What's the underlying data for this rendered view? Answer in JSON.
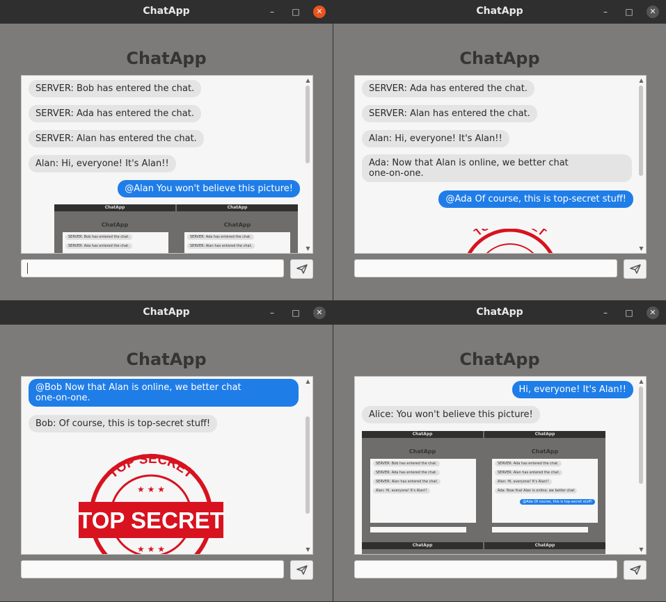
{
  "windows": [
    {
      "title": "ChatApp",
      "app_title": "ChatApp",
      "messages": [
        {
          "text": "SERVER: Bob has entered the chat.",
          "own": false
        },
        {
          "text": "SERVER: Ada has entered the chat.",
          "own": false
        },
        {
          "text": "SERVER: Alan has entered the chat.",
          "own": false
        },
        {
          "text": "Alan: Hi, everyone! It's Alan!!",
          "own": false
        },
        {
          "text": "@Alan You won't believe this picture!",
          "own": true
        }
      ],
      "input_value": "",
      "focused": true
    },
    {
      "title": "ChatApp",
      "app_title": "ChatApp",
      "messages": [
        {
          "text": "SERVER: Ada has entered the chat.",
          "own": false
        },
        {
          "text": "SERVER: Alan has entered the chat.",
          "own": false
        },
        {
          "text": "Alan: Hi, everyone! It's Alan!!",
          "own": false
        },
        {
          "text": "Ada: Now that Alan is online, we better chat\none-on-one.",
          "own": false
        },
        {
          "text": "@Ada Of course, this is top-secret stuff!",
          "own": true
        }
      ],
      "input_value": "",
      "focused": false
    },
    {
      "title": "ChatApp",
      "app_title": "ChatApp",
      "messages": [
        {
          "text": "@Bob Now that Alan is online, we better chat\none-on-one.",
          "own": true
        },
        {
          "text": "Bob: Of course, this is top-secret stuff!",
          "own": false
        }
      ],
      "input_value": "",
      "focused": false
    },
    {
      "title": "ChatApp",
      "app_title": "ChatApp",
      "messages": [
        {
          "text": "Hi, everyone! It's Alan!!",
          "own": true
        },
        {
          "text": "Alice: You won't believe this picture!",
          "own": false
        }
      ],
      "input_value": "",
      "focused": false
    }
  ],
  "stamp": {
    "arc_text": "TOP SECRET",
    "banner_text": "TOP SECRET",
    "color": "#d8121f"
  },
  "thumbnail": {
    "window_title": "ChatApp",
    "app_title": "ChatApp",
    "left_messages": [
      "SERVER: Bob has entered the chat.",
      "SERVER: Ada has entered the chat.",
      "SERVER: Alan has entered the chat.",
      "Alan: Hi, everyone! It's Alan!!"
    ],
    "right_messages": [
      "SERVER: Ada has entered the chat.",
      "SERVER: Alan has entered the chat.",
      "Alan: Hi, everyone! It's Alan!!",
      "Ada: Now that Alan is online, we better chat",
      "@Ada Of course, this is top-secret stuff!"
    ]
  },
  "colors": {
    "own_bubble": "#1f7de8",
    "other_bubble": "#e4e4e4",
    "close_active": "#e95420"
  }
}
